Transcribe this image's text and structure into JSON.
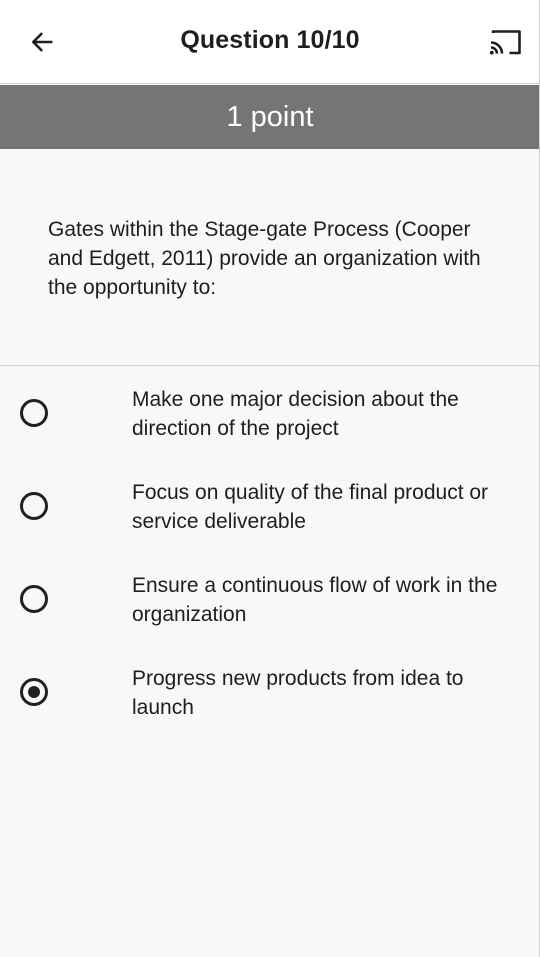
{
  "header": {
    "back_icon": "arrow-left-icon",
    "title": "Question 10/10",
    "cast_icon": "cast-icon"
  },
  "points": {
    "label": "1 point"
  },
  "question": {
    "text": "Gates within the Stage-gate Process (Cooper and Edgett, 2011) provide an organization with the opportunity to:"
  },
  "options": [
    {
      "label": "Make one major decision about the direction of the project",
      "selected": false
    },
    {
      "label": "Focus on quality of the final product or service deliverable",
      "selected": false
    },
    {
      "label": "Ensure a continuous flow of work in the organization",
      "selected": false
    },
    {
      "label": "Progress new products from idea to launch",
      "selected": true
    }
  ],
  "colors": {
    "points_bar": "#757575",
    "background": "#f8f8f7",
    "app_bar": "#ffffff",
    "radio": "#202020"
  }
}
